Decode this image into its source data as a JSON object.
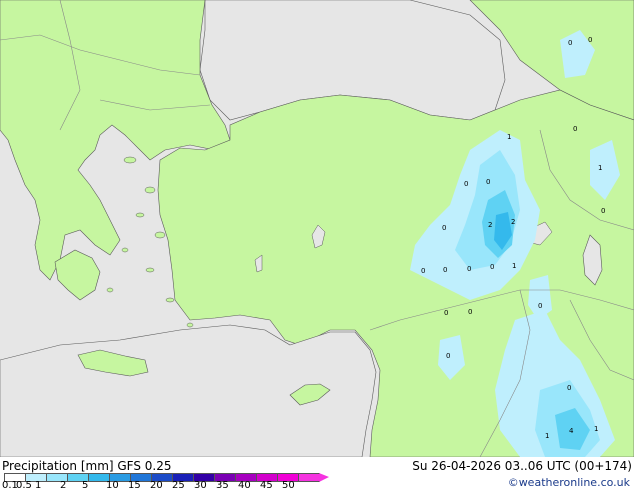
{
  "footer": {
    "title": "Precipitation [mm]  GFS 0.25",
    "run": "Su 26-04-2026 03..06 UTC (00+174)",
    "credit": "©weatheronline.co.uk"
  },
  "legend": {
    "ticks": [
      "0.1",
      "0.5",
      "1",
      "2",
      "5",
      "10",
      "15",
      "20",
      "25",
      "30",
      "35",
      "40",
      "45",
      "50"
    ],
    "colors": [
      "#ffffff",
      "#bfeffd",
      "#99e6fb",
      "#5fd2f3",
      "#34b9ec",
      "#2a9be2",
      "#2076d8",
      "#1c4bc8",
      "#1a20b8",
      "#3200a6",
      "#7a00b4",
      "#a600c0",
      "#d200cc",
      "#f000d6",
      "#f533e0"
    ]
  },
  "map": {
    "colors": {
      "sea": "#e6e6e6",
      "land": "#c6f6a0",
      "border": "#888888",
      "coast": "#5a5a5a"
    },
    "labels": [
      "0",
      "0",
      "1",
      "0",
      "1",
      "0",
      "0",
      "2",
      "2",
      "0",
      "0",
      "0",
      "0",
      "0",
      "1",
      "0",
      "0",
      "0",
      "0",
      "0",
      "0",
      "1",
      "4",
      "1"
    ]
  }
}
